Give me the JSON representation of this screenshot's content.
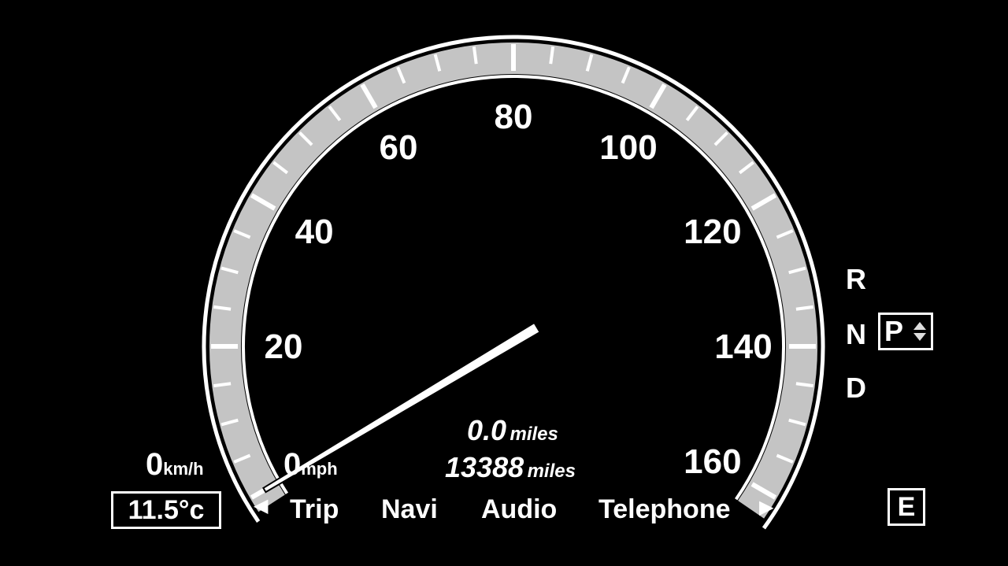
{
  "speedometer": {
    "speed_mph": 0,
    "scale_min": 0,
    "scale_max": 160,
    "scale_labels": [
      "0",
      "20",
      "40",
      "60",
      "80",
      "100",
      "120",
      "140",
      "160"
    ],
    "speed_value": "0",
    "speed_unit": "mph",
    "kmh_value": "0",
    "kmh_unit": "km/h",
    "band_color": "#c4c4c4",
    "needle_color": "#ffffff"
  },
  "trip": {
    "value": "0.0",
    "unit": "miles"
  },
  "odometer": {
    "value": "13388",
    "unit": "miles"
  },
  "temperature": "11.5°c",
  "menu": {
    "items": [
      "Trip",
      "Navi",
      "Audio",
      "Telephone"
    ],
    "left_arrow": "◀",
    "right_arrow": "▶"
  },
  "transmission": {
    "gears": {
      "r": "R",
      "n": "N",
      "d": "D"
    },
    "selected": "P",
    "selector_icon": "up-down-arrows",
    "mode": "E"
  }
}
